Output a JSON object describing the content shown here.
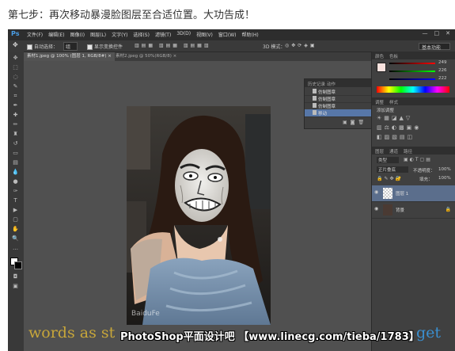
{
  "caption": "第七步：再次移动暴漫脸图层至合适位置。大功告成！",
  "app": {
    "logo": "Ps",
    "menu": [
      "文件(F)",
      "编辑(E)",
      "图像(I)",
      "图层(L)",
      "文字(Y)",
      "选择(S)",
      "滤镜(T)",
      "3D(D)",
      "视图(V)",
      "窗口(W)",
      "帮助(H)"
    ],
    "window_buttons": [
      "—",
      "□",
      "✕"
    ]
  },
  "options_bar": {
    "auto_select_label": "自动选择：",
    "auto_select_value": "组",
    "show_transform_label": "显示变换控件",
    "mode_3d_label": "3D 模式：",
    "workspace": "基本功能"
  },
  "doc_tabs": [
    {
      "label": "素材1.jpeg @ 100% (图层 1, RGB/8#) ×",
      "active": true
    },
    {
      "label": "素材2.jpeg @ 50%(RGB/8) ×",
      "active": false
    }
  ],
  "history_panel": {
    "tabs": [
      "历史记录",
      "动作"
    ],
    "rows": [
      {
        "label": "仿制图章",
        "selected": false
      },
      {
        "label": "仿制图章",
        "selected": false
      },
      {
        "label": "仿制图章",
        "selected": false
      },
      {
        "label": "移动",
        "selected": true
      }
    ]
  },
  "color_panel": {
    "tabs": [
      "颜色",
      "色板"
    ],
    "values": [
      "249",
      "226",
      "222"
    ]
  },
  "adjust_panel": {
    "tabs": [
      "调整",
      "样式"
    ],
    "title": "添加调整"
  },
  "layers_panel": {
    "tabs": [
      "图层",
      "通道",
      "路径"
    ],
    "kind": "类型",
    "blend_mode": "正片叠底",
    "opacity_label": "不透明度：",
    "opacity": "100%",
    "fill_label": "填充：",
    "fill": "100%",
    "layers": [
      {
        "name": "图层 1",
        "selected": true
      },
      {
        "name": "背景",
        "selected": false
      }
    ]
  },
  "photo_watermark": "BaiduFe",
  "bottom_watermark": {
    "left": "words as st",
    "middle": "PhotoShop平面设计吧 【www.linecg.com/tieba/1783】",
    "right": "get"
  },
  "colors": {
    "ps_gray": "#535353",
    "panel": "#404040",
    "highlight": "#5777a8",
    "ps_blue": "#4a9ee6"
  }
}
